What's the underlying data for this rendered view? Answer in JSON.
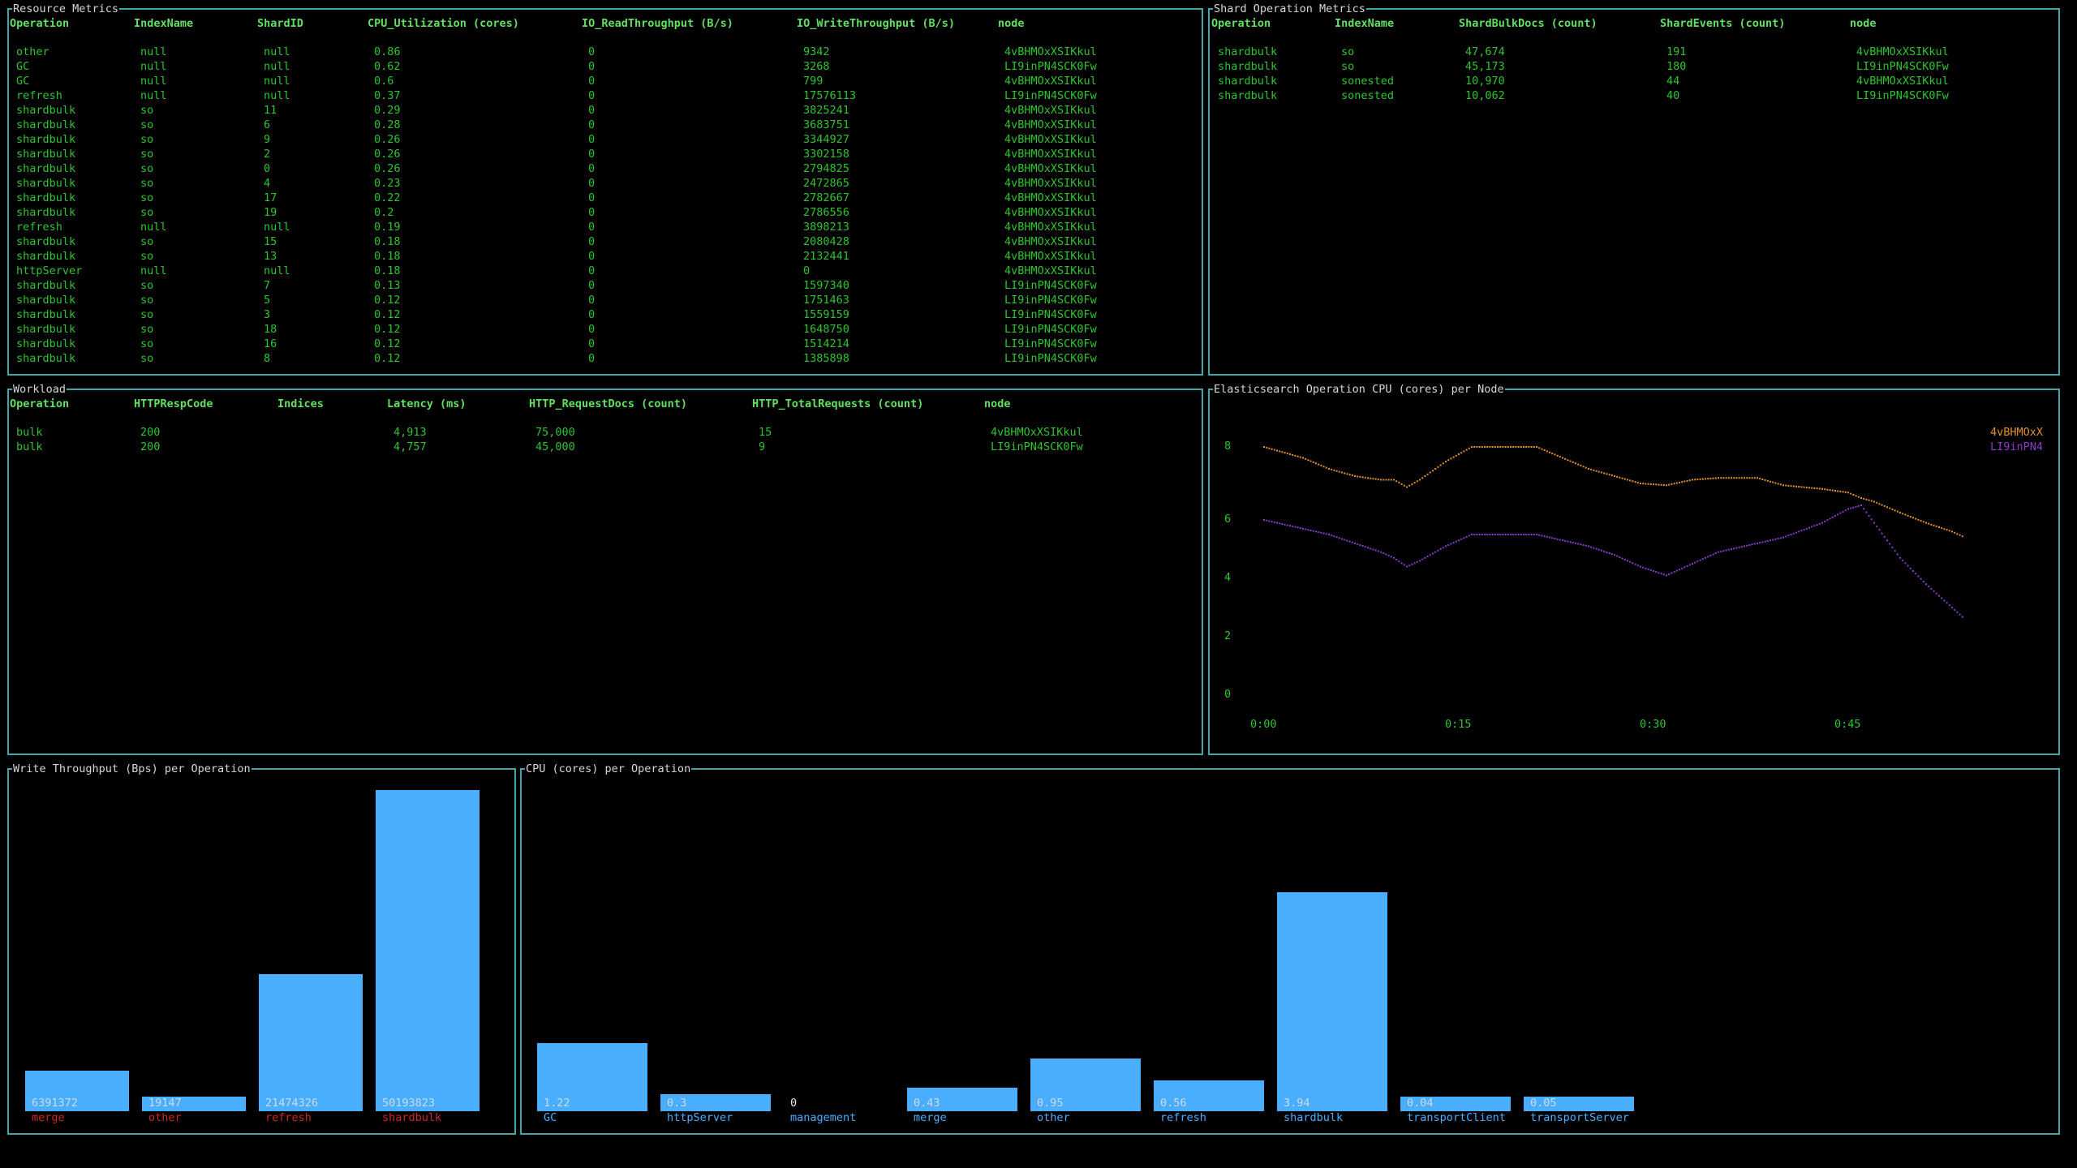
{
  "resource_metrics": {
    "title": "Resource Metrics",
    "columns": [
      "Operation",
      "IndexName",
      "ShardID",
      "CPU_Utilization (cores)",
      "IO_ReadThroughput (B/s)",
      "IO_WriteThroughput (B/s)",
      "node"
    ],
    "rows": [
      [
        "other",
        "null",
        "null",
        "0.86",
        "0",
        "9342",
        "4vBHMOxXSIKkul"
      ],
      [
        "GC",
        "null",
        "null",
        "0.62",
        "0",
        "3268",
        "LI9inPN4SCK0Fw"
      ],
      [
        "GC",
        "null",
        "null",
        "0.6",
        "0",
        "799",
        "4vBHMOxXSIKkul"
      ],
      [
        "refresh",
        "null",
        "null",
        "0.37",
        "0",
        "17576113",
        "LI9inPN4SCK0Fw"
      ],
      [
        "shardbulk",
        "so",
        "11",
        "0.29",
        "0",
        "3825241",
        "4vBHMOxXSIKkul"
      ],
      [
        "shardbulk",
        "so",
        "6",
        "0.28",
        "0",
        "3683751",
        "4vBHMOxXSIKkul"
      ],
      [
        "shardbulk",
        "so",
        "9",
        "0.26",
        "0",
        "3344927",
        "4vBHMOxXSIKkul"
      ],
      [
        "shardbulk",
        "so",
        "2",
        "0.26",
        "0",
        "3302158",
        "4vBHMOxXSIKkul"
      ],
      [
        "shardbulk",
        "so",
        "0",
        "0.26",
        "0",
        "2794825",
        "4vBHMOxXSIKkul"
      ],
      [
        "shardbulk",
        "so",
        "4",
        "0.23",
        "0",
        "2472865",
        "4vBHMOxXSIKkul"
      ],
      [
        "shardbulk",
        "so",
        "17",
        "0.22",
        "0",
        "2782667",
        "4vBHMOxXSIKkul"
      ],
      [
        "shardbulk",
        "so",
        "19",
        "0.2",
        "0",
        "2786556",
        "4vBHMOxXSIKkul"
      ],
      [
        "refresh",
        "null",
        "null",
        "0.19",
        "0",
        "3898213",
        "4vBHMOxXSIKkul"
      ],
      [
        "shardbulk",
        "so",
        "15",
        "0.18",
        "0",
        "2080428",
        "4vBHMOxXSIKkul"
      ],
      [
        "shardbulk",
        "so",
        "13",
        "0.18",
        "0",
        "2132441",
        "4vBHMOxXSIKkul"
      ],
      [
        "httpServer",
        "null",
        "null",
        "0.18",
        "0",
        "0",
        "4vBHMOxXSIKkul"
      ],
      [
        "shardbulk",
        "so",
        "7",
        "0.13",
        "0",
        "1597340",
        "LI9inPN4SCK0Fw"
      ],
      [
        "shardbulk",
        "so",
        "5",
        "0.12",
        "0",
        "1751463",
        "LI9inPN4SCK0Fw"
      ],
      [
        "shardbulk",
        "so",
        "3",
        "0.12",
        "0",
        "1559159",
        "LI9inPN4SCK0Fw"
      ],
      [
        "shardbulk",
        "so",
        "18",
        "0.12",
        "0",
        "1648750",
        "LI9inPN4SCK0Fw"
      ],
      [
        "shardbulk",
        "so",
        "16",
        "0.12",
        "0",
        "1514214",
        "LI9inPN4SCK0Fw"
      ],
      [
        "shardbulk",
        "so",
        "8",
        "0.12",
        "0",
        "1385898",
        "LI9inPN4SCK0Fw"
      ]
    ]
  },
  "shard_operation_metrics": {
    "title": "Shard Operation Metrics",
    "columns": [
      "Operation",
      "IndexName",
      "ShardBulkDocs (count)",
      "ShardEvents (count)",
      "node"
    ],
    "rows": [
      [
        "shardbulk",
        "so",
        "47,674",
        "191",
        "4vBHMOxXSIKkul"
      ],
      [
        "shardbulk",
        "so",
        "45,173",
        "180",
        "LI9inPN4SCK0Fw"
      ],
      [
        "shardbulk",
        "sonested",
        "10,970",
        "44",
        "4vBHMOxXSIKkul"
      ],
      [
        "shardbulk",
        "sonested",
        "10,062",
        "40",
        "LI9inPN4SCK0Fw"
      ]
    ]
  },
  "workload": {
    "title": "Workload",
    "columns": [
      "Operation",
      "HTTPRespCode",
      "Indices",
      "Latency (ms)",
      "HTTP_RequestDocs (count)",
      "HTTP_TotalRequests (count)",
      "node"
    ],
    "rows": [
      [
        "bulk",
        "200",
        "",
        "4,913",
        "75,000",
        "15",
        "4vBHMOxXSIKkul"
      ],
      [
        "bulk",
        "200",
        "",
        "4,757",
        "45,000",
        "9",
        "LI9inPN4SCK0Fw"
      ]
    ]
  },
  "colors": {
    "border": "#3fa7a8",
    "header_text": "#62e062",
    "cell_text": "#2ec42e",
    "bar_fill": "#4aaeff",
    "bar_label_red": "#d0281a",
    "series_orange": "#e0902c",
    "series_purple": "#8a3cc8"
  },
  "chart_data": [
    {
      "type": "line",
      "title": "Elasticsearch Operation CPU (cores) per Node",
      "xlabel": "",
      "ylabel": "",
      "x_ticks": [
        "0:00",
        "0:15",
        "0:30",
        "0:45"
      ],
      "x_tick_values": [
        0,
        15,
        30,
        45
      ],
      "y_ticks": [
        "8",
        "6",
        "4",
        "2",
        "0"
      ],
      "y_tick_values": [
        8,
        6,
        4,
        2,
        0
      ],
      "xlim": [
        0,
        54
      ],
      "ylim": [
        0,
        8
      ],
      "legend_position": "top-right",
      "grid": false,
      "x": [
        0,
        3,
        5,
        7,
        9,
        10,
        11,
        12,
        14,
        16,
        18,
        21,
        23,
        25,
        27,
        29,
        31,
        33,
        35,
        38,
        40,
        43,
        45,
        46,
        47,
        49,
        51,
        53,
        54
      ],
      "series": [
        {
          "name": "4vBHMOxX",
          "color": "#e0902c",
          "values": [
            8.0,
            7.7,
            7.4,
            7.2,
            7.1,
            7.1,
            6.9,
            7.1,
            7.6,
            8.0,
            8.0,
            8.0,
            7.7,
            7.4,
            7.2,
            7.0,
            6.95,
            7.1,
            7.15,
            7.15,
            6.95,
            6.85,
            6.75,
            6.6,
            6.5,
            6.2,
            5.9,
            5.6,
            5.4
          ]
        },
        {
          "name": "LI9inPN4",
          "color": "#8a3cc8",
          "values": [
            6.0,
            5.7,
            5.5,
            5.2,
            4.9,
            4.7,
            4.4,
            4.6,
            5.1,
            5.5,
            5.5,
            5.5,
            5.3,
            5.1,
            4.8,
            4.4,
            4.1,
            4.5,
            4.9,
            5.2,
            5.4,
            5.9,
            6.3,
            6.4,
            5.9,
            4.7,
            3.8,
            3.0,
            2.6
          ]
        }
      ]
    },
    {
      "type": "bar",
      "title": "Write Throughput (Bps) per Operation",
      "categories": [
        "merge",
        "other",
        "refresh",
        "shardbulk"
      ],
      "values": [
        6391372,
        19147,
        21474326,
        50193823
      ],
      "value_labels": [
        "6391372",
        "19147",
        "21474326",
        "50193823"
      ],
      "xlabel": "",
      "ylabel": "",
      "ylim": [
        0,
        50193823
      ]
    },
    {
      "type": "bar",
      "title": "CPU (cores) per Operation",
      "categories": [
        "GC",
        "httpServer",
        "management",
        "merge",
        "other",
        "refresh",
        "shardbulk",
        "transportClient",
        "transportServer"
      ],
      "values": [
        1.22,
        0.3,
        0,
        0.43,
        0.95,
        0.56,
        3.94,
        0.04,
        0.05
      ],
      "value_labels": [
        "1.22",
        "0.3",
        "0",
        "0.43",
        "0.95",
        "0.56",
        "3.94",
        "0.04",
        "0.05"
      ],
      "xlabel": "",
      "ylabel": "",
      "ylim": [
        0,
        3.94
      ]
    }
  ]
}
